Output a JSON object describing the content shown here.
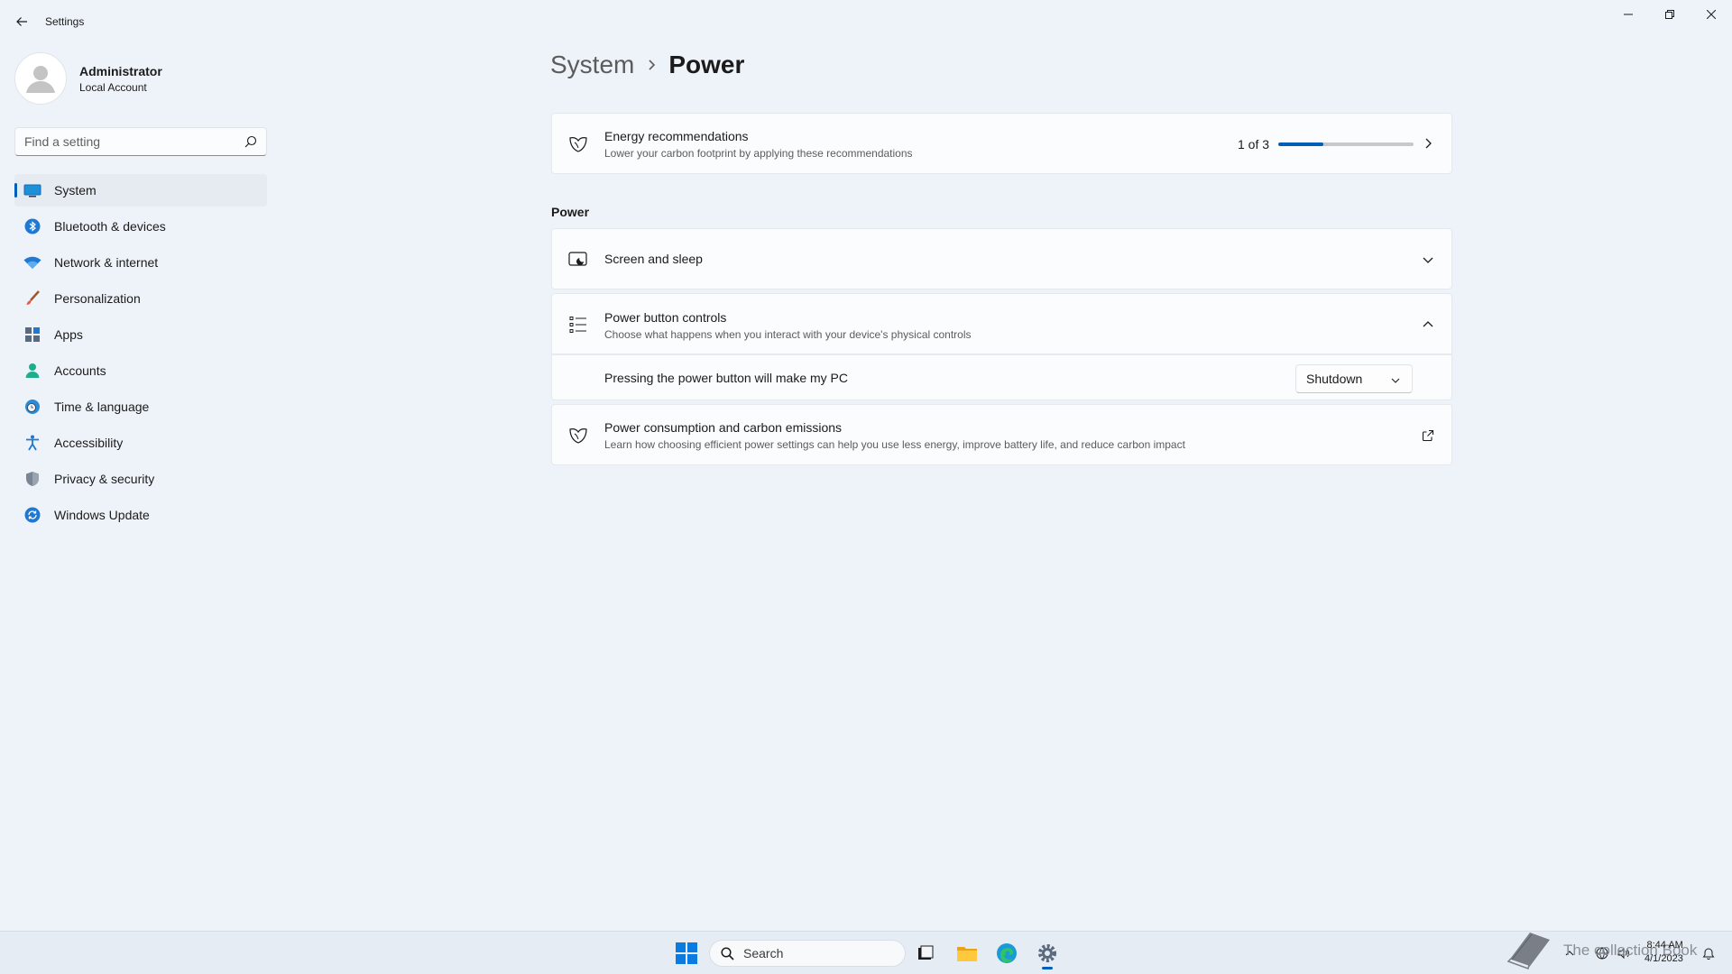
{
  "window": {
    "app_title": "Settings"
  },
  "profile": {
    "name": "Administrator",
    "account_type": "Local Account"
  },
  "search": {
    "placeholder": "Find a setting"
  },
  "sidebar": {
    "items": [
      {
        "label": "System",
        "icon": "system-icon",
        "active": true
      },
      {
        "label": "Bluetooth & devices",
        "icon": "bluetooth-icon"
      },
      {
        "label": "Network & internet",
        "icon": "wifi-icon"
      },
      {
        "label": "Personalization",
        "icon": "brush-icon"
      },
      {
        "label": "Apps",
        "icon": "apps-icon"
      },
      {
        "label": "Accounts",
        "icon": "person-icon"
      },
      {
        "label": "Time & language",
        "icon": "globe-clock-icon"
      },
      {
        "label": "Accessibility",
        "icon": "accessibility-icon"
      },
      {
        "label": "Privacy & security",
        "icon": "shield-icon"
      },
      {
        "label": "Windows Update",
        "icon": "update-icon"
      }
    ]
  },
  "breadcrumb": {
    "parent": "System",
    "current": "Power"
  },
  "energy": {
    "title": "Energy recommendations",
    "subtitle": "Lower your carbon footprint by applying these recommendations",
    "progress_label": "1 of 3",
    "progress_fraction": 0.333
  },
  "power_section": {
    "heading": "Power",
    "screen_sleep": {
      "title": "Screen and sleep"
    },
    "power_button": {
      "title": "Power button controls",
      "subtitle": "Choose what happens when you interact with your device's physical controls",
      "row_label": "Pressing the power button will make my PC",
      "selected_option": "Shutdown"
    },
    "consumption": {
      "title": "Power consumption and carbon emissions",
      "subtitle": "Learn how choosing efficient power settings can help you use less energy, improve battery life, and reduce carbon impact"
    }
  },
  "taskbar": {
    "search_label": "Search",
    "watermark_text": "The collection Book",
    "time": "8:44 AM",
    "date": "4/1/2023"
  },
  "colors": {
    "accent": "#005fb8",
    "background": "#eef3f9",
    "card": "#fbfcfd"
  }
}
